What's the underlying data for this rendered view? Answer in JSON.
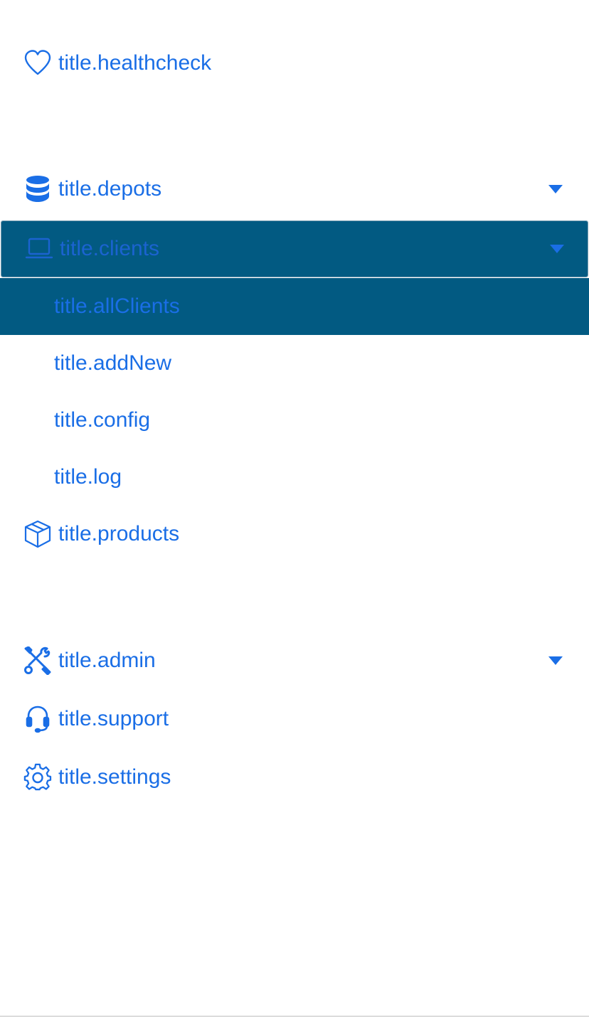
{
  "nav": {
    "healthcheck": {
      "label": "title.healthcheck",
      "icon": "heart-icon"
    },
    "depots": {
      "label": "title.depots",
      "icon": "database-icon"
    },
    "clients": {
      "label": "title.clients",
      "icon": "laptop-icon",
      "expanded": true
    },
    "clients_sub": {
      "all_clients": {
        "label": "title.allClients",
        "selected": true
      },
      "add_new": {
        "label": "title.addNew"
      },
      "config": {
        "label": "title.config"
      },
      "log": {
        "label": "title.log"
      }
    },
    "products": {
      "label": "title.products",
      "icon": "box-icon"
    },
    "admin": {
      "label": "title.admin",
      "icon": "tools-icon"
    },
    "support": {
      "label": "title.support",
      "icon": "headset-icon"
    },
    "settings": {
      "label": "title.settings",
      "icon": "gear-icon"
    }
  },
  "colors": {
    "link": "#1a6ee6",
    "active_bg": "#025a82",
    "background": "#ffffff"
  }
}
